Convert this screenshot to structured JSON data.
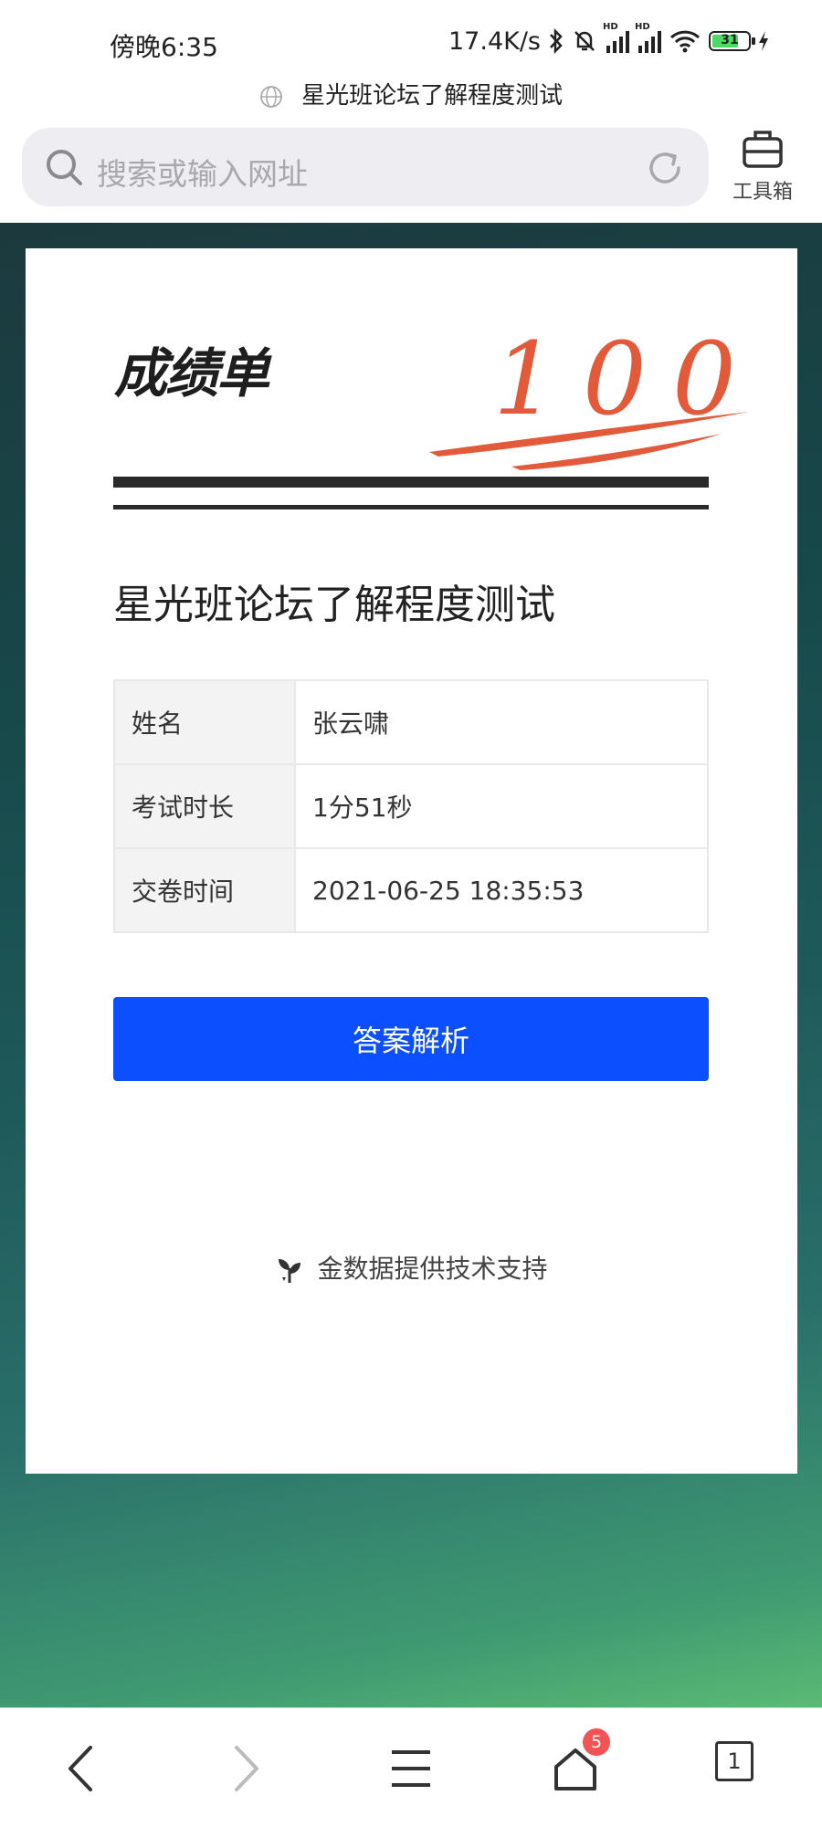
{
  "status_bar": {
    "time": "傍晚6:35",
    "net_speed": "17.4K/s",
    "signal_tag": "HD",
    "battery_level": "31"
  },
  "page": {
    "title": "星光班论坛了解程度测试"
  },
  "url_bar": {
    "placeholder": "搜索或输入网址"
  },
  "toolbox": {
    "label": "工具箱"
  },
  "report": {
    "logo_text": "成绩单",
    "score": "100",
    "quiz_title": "星光班论坛了解程度测试",
    "rows": [
      {
        "key": "姓名",
        "value": "张云啸"
      },
      {
        "key": "考试时长",
        "value": "1分51秒"
      },
      {
        "key": "交卷时间",
        "value": "2021-06-25 18:35:53"
      }
    ],
    "answer_button": "答案解析",
    "support_text": "金数据提供技术支持"
  },
  "bottom_nav": {
    "badge": "5",
    "tab_count": "1"
  },
  "colors": {
    "accent_button": "#0b4fff",
    "score_red": "#e25a3a",
    "badge_red": "#f25454"
  }
}
